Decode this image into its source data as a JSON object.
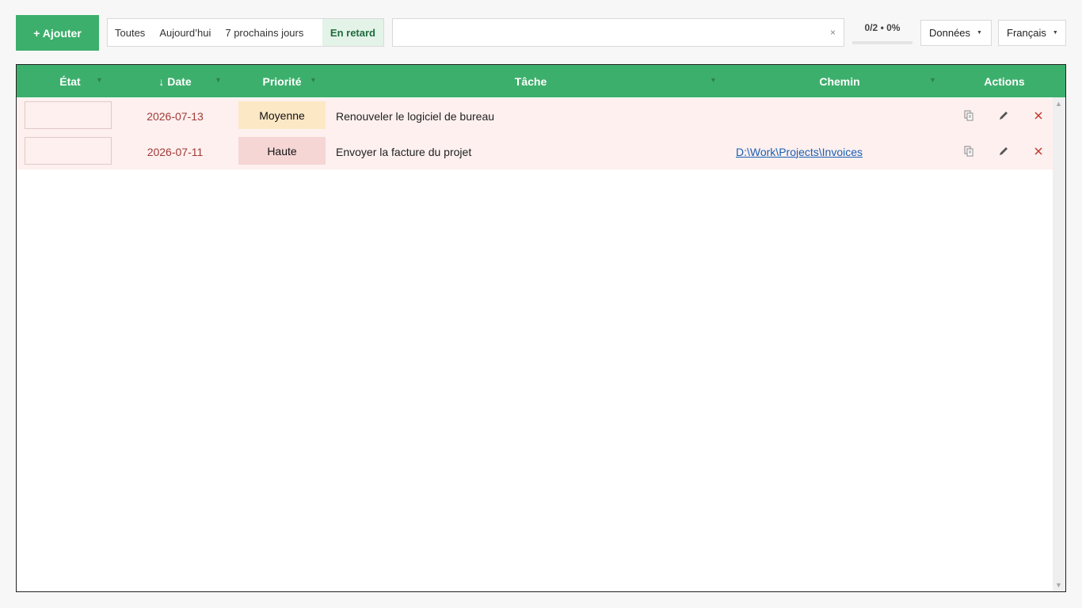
{
  "toolbar": {
    "add_label": "+ Ajouter",
    "filters": [
      "Toutes",
      "Aujourd’hui",
      "7 prochains jours",
      "En retard"
    ],
    "search_clear": "×",
    "progress_text": "0/2 • 0%",
    "progress_fraction": 0,
    "data_label": "Données",
    "lang_label": "Français",
    "caret": "▼"
  },
  "grid": {
    "columns": {
      "state": "État",
      "date": "↓ Date",
      "priority": "Priorité",
      "task": "Tâche",
      "path": "Chemin",
      "actions": "Actions"
    },
    "filter_glyph": "▼",
    "rows": [
      {
        "date": "2026-07-13",
        "priority": "Moyenne",
        "priority_color": "#fde8c6",
        "task": "Renouveler le logiciel de bureau",
        "path": ""
      },
      {
        "date": "2026-07-11",
        "priority": "Haute",
        "priority_color": "#f6d5d5",
        "task": "Envoyer la facture du projet",
        "path": "D:\\Work\\Projects\\Invoices"
      }
    ],
    "scroll_up": "▲",
    "scroll_down": "▼"
  },
  "colors": {
    "accent": "#3daf6c",
    "row_overdue_bg": "#fdf0ef",
    "date_overdue": "#a33b36",
    "delete": "#c0392b"
  }
}
